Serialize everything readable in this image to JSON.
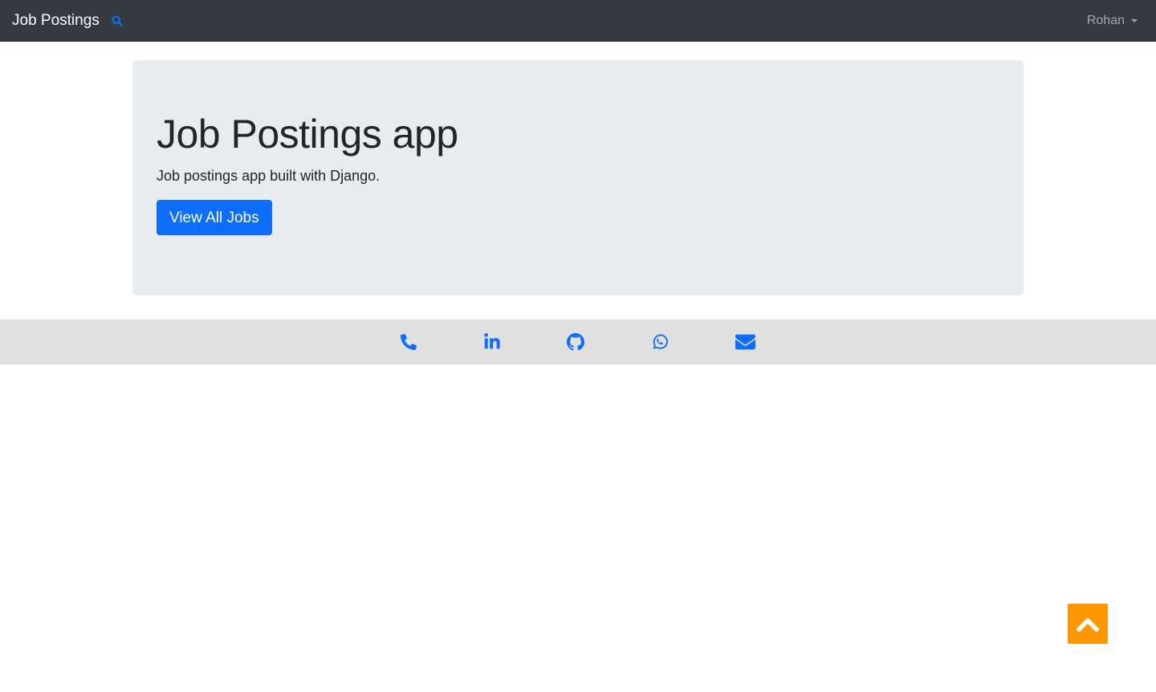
{
  "navbar": {
    "brand": "Job Postings",
    "search_icon": "search-icon",
    "user_menu": {
      "label": "Rohan",
      "icon": "caret-down-icon"
    }
  },
  "hero": {
    "title": "Job Postings app",
    "subtitle": "Job postings app built with Django.",
    "button_label": "View All Jobs"
  },
  "footer": {
    "links": [
      {
        "icon": "phone-icon"
      },
      {
        "icon": "linkedin-icon"
      },
      {
        "icon": "github-icon"
      },
      {
        "icon": "whatsapp-icon"
      },
      {
        "icon": "envelope-icon"
      }
    ]
  },
  "back_to_top": {
    "icon": "chevron-up-icon"
  },
  "colors": {
    "navbar_bg": "#343a40",
    "primary": "#0d6efd",
    "hero_bg": "#e9ecef",
    "footer_bg": "#e0e0e0",
    "back_to_top_bg": "#ff9800"
  }
}
